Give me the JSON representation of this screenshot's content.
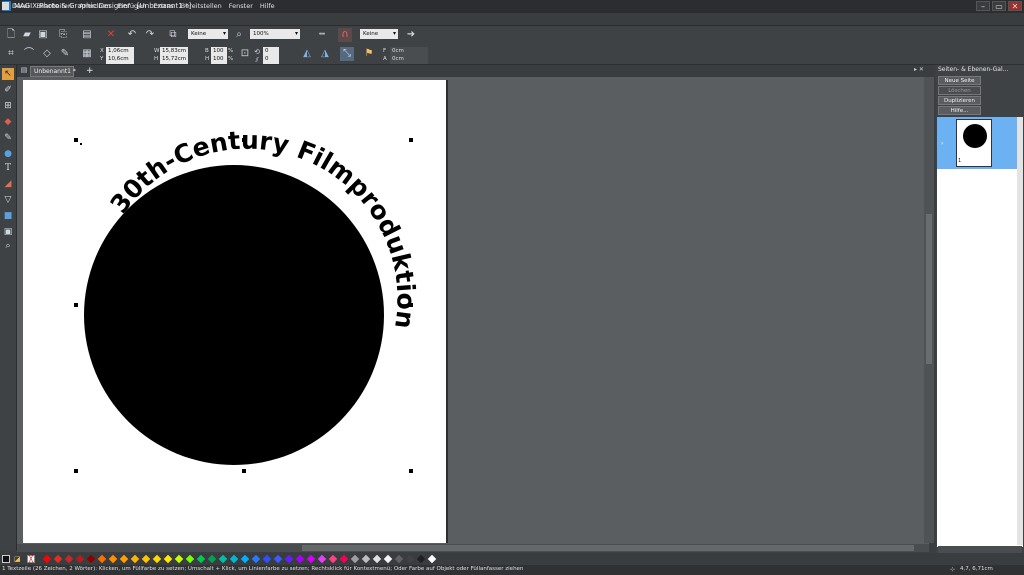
{
  "window": {
    "title": "MAGIX Photo & Graphic Designer - [Unbenannt1 *]",
    "controls": [
      "–",
      "▭",
      "✕"
    ]
  },
  "menu": [
    "Datei",
    "Bearbeiten",
    "Anordnen",
    "Einfügen",
    "Extras",
    "Bereitstellen",
    "Fenster",
    "Hilfe"
  ],
  "toolbar1": {
    "fill_dropdown": "Keine",
    "zoom_value": "100%",
    "line_dropdown": "Keine"
  },
  "toolbar2": {
    "x_label": "X",
    "x_value": "1,06cm",
    "y_label": "Y",
    "y_value": "10,6cm",
    "w_label": "W",
    "w_value": "15,83cm",
    "h_label": "H",
    "h_value": "15,72cm",
    "b_label": "B",
    "b_pct": "100",
    "h2_label": "H",
    "h_pct": "100",
    "pct": "%",
    "rot_value": "0",
    "skew_value": "0",
    "f_label": "F",
    "f_value": "0cm",
    "a_label": "A",
    "a_value": "0cm"
  },
  "document": {
    "tab_label": "Unbenannt1 *",
    "add_tab": "+",
    "curved_text": "30th-Century Filmproduktion"
  },
  "right_panel": {
    "title": "Seiten- & Ebenen-Gal...",
    "buttons": [
      "Neue Seite",
      "Löschen",
      "Duplizieren",
      "Hilfe..."
    ],
    "page_number": "1"
  },
  "palette_colors": [
    "#ff0000",
    "#e0301e",
    "#c62828",
    "#b71c1c",
    "#8e0000",
    "#ff6f00",
    "#ff8f00",
    "#ffa000",
    "#ffb300",
    "#ffc400",
    "#ffd600",
    "#ffea00",
    "#c6ff00",
    "#76ff03",
    "#00c853",
    "#00a152",
    "#00bfa5",
    "#00b8d4",
    "#00b0ff",
    "#2979ff",
    "#304ffe",
    "#3d5afe",
    "#651fff",
    "#aa00ff",
    "#d500f9",
    "#e040fb",
    "#ff4081",
    "#f50057",
    "#9e9e9e",
    "#bdbdbd",
    "#e0e0e0",
    "#f5f5f5",
    "#616161",
    "#424242",
    "#212121",
    "#ffffff"
  ],
  "status": {
    "text": "1 Textzeile (26 Zeichen, 2 Wörter): Klicken, um Füllfarbe zu setzen; Umschalt + Klick, um Linienfarbe zu setzen; Rechtsklick für Kontextmenü; Oder Farbe auf Objekt oder Füllanfasser ziehen",
    "coords": "4,7, 6,71cm"
  }
}
